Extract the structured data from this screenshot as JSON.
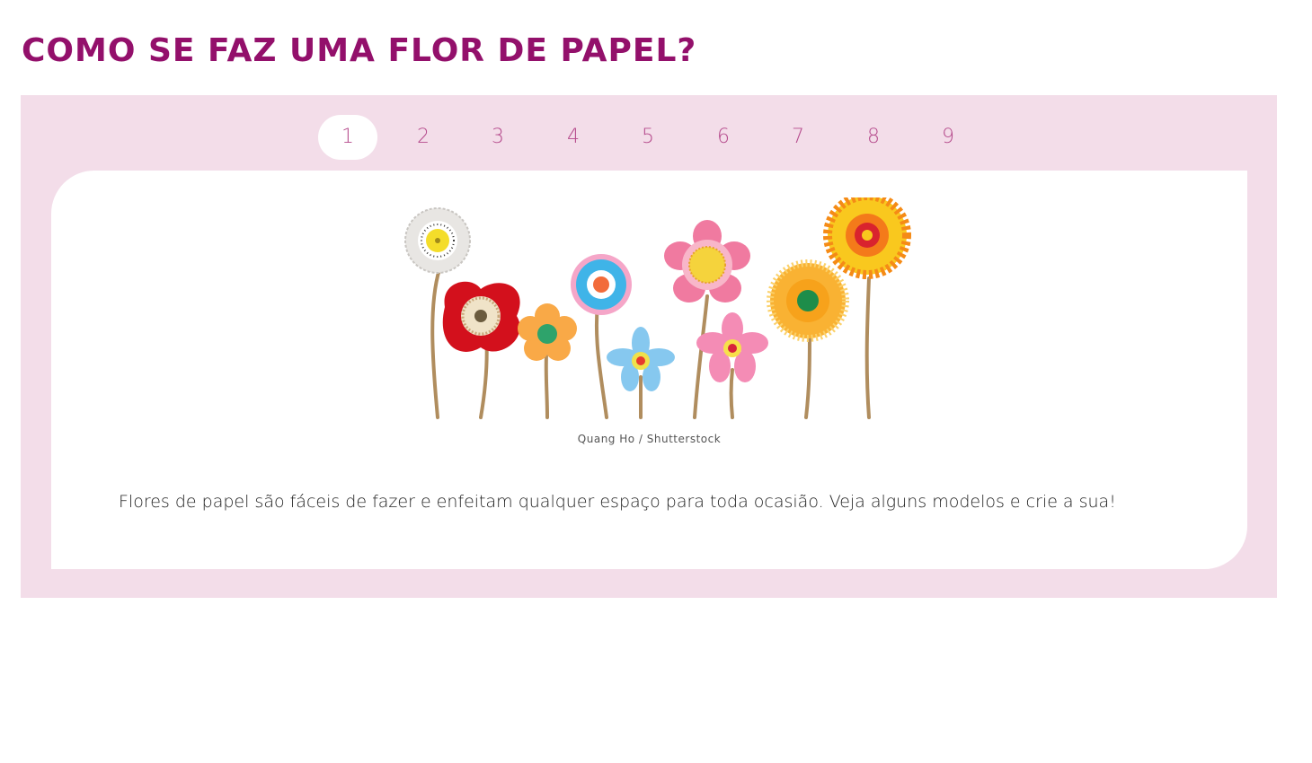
{
  "title": "COMO SE FAZ UMA FLOR DE PAPEL?",
  "steps": {
    "active": 1,
    "labels": [
      "1",
      "2",
      "3",
      "4",
      "5",
      "6",
      "7",
      "8",
      "9"
    ]
  },
  "image": {
    "subject": "paper-flowers-illustration",
    "caption": "Quang Ho / Shutterstock"
  },
  "body_text": "Flores de papel são fáceis de fazer e enfeitam qualquer espaço para toda ocasião. Veja alguns modelos e crie a sua!",
  "colors": {
    "title": "#93106b",
    "panel_bg": "#f3dde9",
    "step_text": "#b54a8c",
    "card_bg": "#ffffff"
  }
}
